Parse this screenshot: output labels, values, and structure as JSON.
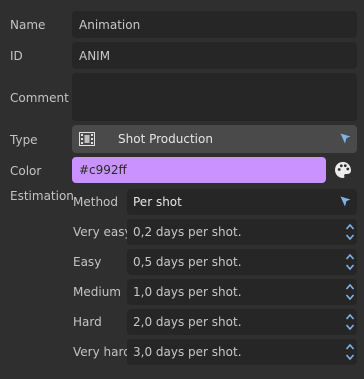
{
  "fields": {
    "name_label": "Name",
    "name_value": "Animation",
    "id_label": "ID",
    "id_value": "ANIM",
    "comment_label": "Comment",
    "comment_value": "",
    "type_label": "Type",
    "type_value": "Shot Production",
    "type_icon": "film-icon",
    "color_label": "Color",
    "color_value": "#c992ff",
    "estimation_label": "Estimation"
  },
  "estimation": {
    "method_label": "Method",
    "method_value": "Per shot",
    "rows": [
      {
        "label": "Very easy",
        "value": "0,2 days per shot."
      },
      {
        "label": "Easy",
        "value": "0,5 days per shot."
      },
      {
        "label": "Medium",
        "value": "1,0 days per shot."
      },
      {
        "label": "Hard",
        "value": "2,0 days per shot."
      },
      {
        "label": "Very hard",
        "value": "3,0 days per shot."
      }
    ]
  },
  "colors": {
    "accent": "#7fb2e6",
    "swatch": "#c992ff",
    "background": "#2f2f2f",
    "field": "#262626"
  }
}
